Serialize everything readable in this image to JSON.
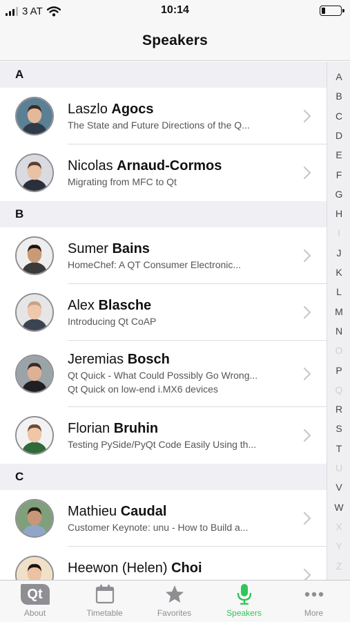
{
  "status_bar": {
    "carrier": "3 AT",
    "time": "10:14"
  },
  "nav": {
    "title": "Speakers"
  },
  "sections": [
    {
      "letter": "A",
      "rows": [
        {
          "first": "Laszlo",
          "last": "Agocs",
          "talks": [
            "The State and Future Directions of the Q..."
          ]
        },
        {
          "first": "Nicolas",
          "last": "Arnaud-Cormos",
          "talks": [
            "Migrating from MFC to Qt"
          ]
        }
      ]
    },
    {
      "letter": "B",
      "rows": [
        {
          "first": "Sumer",
          "last": "Bains",
          "talks": [
            "HomeChef: A QT Consumer Electronic..."
          ]
        },
        {
          "first": "Alex",
          "last": "Blasche",
          "talks": [
            "Introducing Qt CoAP"
          ]
        },
        {
          "first": "Jeremias",
          "last": "Bosch",
          "talks": [
            "Qt Quick - What Could Possibly Go Wrong...",
            "Qt Quick on low-end i.MX6 devices"
          ]
        },
        {
          "first": "Florian",
          "last": "Bruhin",
          "talks": [
            "Testing PySide/PyQt Code Easily Using th..."
          ]
        }
      ]
    },
    {
      "letter": "C",
      "rows": [
        {
          "first": "Mathieu",
          "last": "Caudal",
          "talks": [
            "Customer Keynote: unu - How to Build a..."
          ]
        },
        {
          "first": "Heewon (Helen)",
          "last": "Choi",
          "talks": [
            ""
          ]
        }
      ]
    }
  ],
  "index_letters": [
    "A",
    "B",
    "C",
    "D",
    "E",
    "F",
    "G",
    "H",
    "I",
    "J",
    "K",
    "L",
    "M",
    "N",
    "O",
    "P",
    "Q",
    "R",
    "S",
    "T",
    "U",
    "V",
    "W",
    "X",
    "Y",
    "Z"
  ],
  "index_dimmed": [
    "I",
    "O",
    "Q",
    "U",
    "X",
    "Y",
    "Z"
  ],
  "tabs": [
    {
      "label": "About",
      "icon": "qt-logo-icon",
      "logo_text": "Qt"
    },
    {
      "label": "Timetable",
      "icon": "calendar-icon"
    },
    {
      "label": "Favorites",
      "icon": "star-icon"
    },
    {
      "label": "Speakers",
      "icon": "microphone-icon"
    },
    {
      "label": "More",
      "icon": "more-dots-icon"
    }
  ],
  "active_tab": "Speakers",
  "colors": {
    "accent": "#2ec559",
    "tab_inactive": "#8e8e93",
    "section_bg": "#efeff4"
  }
}
